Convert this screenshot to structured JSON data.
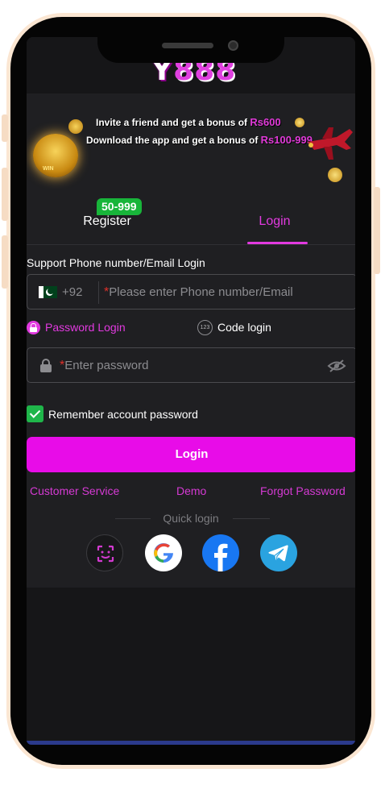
{
  "app": {
    "logo_prefix": "Y",
    "logo_digits": "888"
  },
  "banner": {
    "line1_text": "Invite a friend and get a bonus of",
    "line1_amount": "Rs600",
    "line2_text": "Download the app and get a bonus of",
    "line2_amount": "Rs100-999",
    "mascot_label": "WIN"
  },
  "tabs": {
    "register_label": "Register",
    "register_badge": "50-999",
    "login_label": "Login",
    "active": "Login"
  },
  "form": {
    "support_label": "Support Phone number/Email Login",
    "country_code": "+92",
    "phone_placeholder": "Please enter Phone number/Email",
    "password_login_label": "Password Login",
    "code_login_label": "Code login",
    "code_icon_text": "123",
    "password_placeholder": "Enter password",
    "remember_label": "Remember account password",
    "remember_checked": true,
    "login_button": "Login"
  },
  "links": {
    "customer_service": "Customer Service",
    "demo": "Demo",
    "forgot_password": "Forgot Password"
  },
  "quick_login": {
    "label": "Quick login",
    "providers": [
      "face-id-icon",
      "google-icon",
      "facebook-icon",
      "telegram-icon"
    ]
  },
  "colors": {
    "accent": "#e23ae0",
    "button": "#e80ce8",
    "check": "#1fb64a",
    "badge": "#18b53a",
    "background": "#1f1f22"
  }
}
